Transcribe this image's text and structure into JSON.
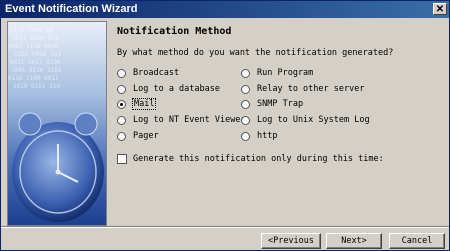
{
  "window": {
    "title": "Event Notification Wizard",
    "close_glyph": "✕"
  },
  "header": {
    "title": "Notification Method"
  },
  "question": "By what method do you want the notification generated?",
  "options_left": [
    {
      "label": "Broadcast",
      "selected": false
    },
    {
      "label": "Log to a database",
      "selected": false
    },
    {
      "label": "Mail",
      "selected": true
    },
    {
      "label": "Log to NT Event Viewer",
      "selected": false
    },
    {
      "label": "Pager",
      "selected": false
    }
  ],
  "options_right": [
    {
      "label": "Run Program",
      "selected": false
    },
    {
      "label": "Relay to other server",
      "selected": false
    },
    {
      "label": "SNMP Trap",
      "selected": false
    },
    {
      "label": "Log to Unix System Log",
      "selected": false
    },
    {
      "label": "http",
      "selected": false
    }
  ],
  "time_checkbox": {
    "label": "Generate this notification only during this time:",
    "checked": false
  },
  "buttons": {
    "previous": "<Previous",
    "next": "Next>",
    "cancel": "Cancel"
  },
  "colors": {
    "titlebar_start": "#0a246a",
    "titlebar_end": "#3a6ea5",
    "dialog_bg": "#d4d0c8",
    "art_blue": "#1c3f8f"
  },
  "icons": {
    "art": "alarm-clock-art-icon"
  }
}
